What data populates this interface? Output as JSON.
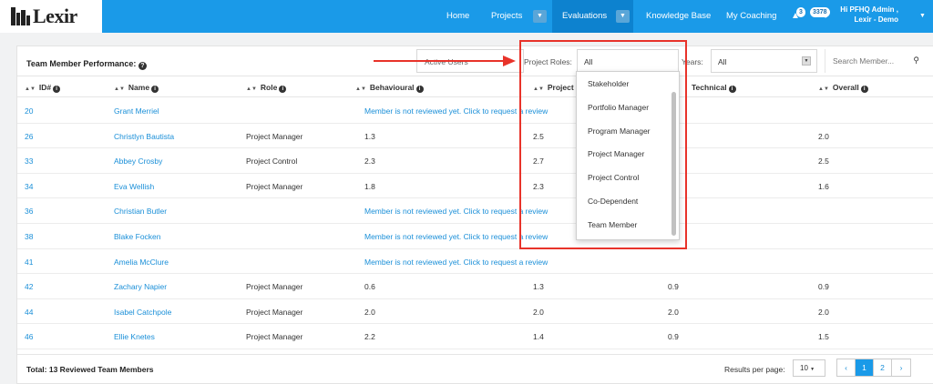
{
  "brand": {
    "logo_text": "Lexir"
  },
  "nav": {
    "items": [
      "Home",
      "Projects",
      "Evaluations",
      "Knowledge Base",
      "My Coaching"
    ],
    "notifications": {
      "alerts": "3",
      "messages": "3378"
    },
    "user_line1": "Hi PFHQ Admin ,",
    "user_line2": "Lexir - Demo"
  },
  "panel": {
    "title": "Team Member Performance:",
    "filters": {
      "users_label": "Active Users",
      "roles_label": "Project Roles:",
      "roles_value": "All",
      "years_label": "Years:",
      "years_value": "All",
      "search_placeholder": "Search Member..."
    },
    "columns": [
      "ID#",
      "Name",
      "Role",
      "Behavioural",
      "Project",
      "Technical",
      "Overall"
    ],
    "not_reviewed_text": "Member is not reviewed yet. Click to request a review",
    "rows": [
      {
        "id": "20",
        "name": "Grant Merriel",
        "role": "",
        "behavioural": "",
        "project": "",
        "technical": "",
        "overall": "",
        "reviewed": false
      },
      {
        "id": "26",
        "name": "Christlyn Bautista",
        "role": "Project Manager",
        "behavioural": "1.3",
        "project": "2.5",
        "technical": "",
        "overall": "2.0",
        "reviewed": true
      },
      {
        "id": "33",
        "name": "Abbey Crosby",
        "role": "Project Control",
        "behavioural": "2.3",
        "project": "2.7",
        "technical": "",
        "overall": "2.5",
        "reviewed": true
      },
      {
        "id": "34",
        "name": "Eva Wellish",
        "role": "Project Manager",
        "behavioural": "1.8",
        "project": "2.3",
        "technical": "",
        "overall": "1.6",
        "reviewed": true
      },
      {
        "id": "36",
        "name": "Christian Butler",
        "role": "",
        "behavioural": "",
        "project": "",
        "technical": "",
        "overall": "",
        "reviewed": false
      },
      {
        "id": "38",
        "name": "Blake Focken",
        "role": "",
        "behavioural": "",
        "project": "",
        "technical": "",
        "overall": "",
        "reviewed": false
      },
      {
        "id": "41",
        "name": "Amelia McClure",
        "role": "",
        "behavioural": "",
        "project": "",
        "technical": "",
        "overall": "",
        "reviewed": false
      },
      {
        "id": "42",
        "name": "Zachary Napier",
        "role": "Project Manager",
        "behavioural": "0.6",
        "project": "1.3",
        "technical": "0.9",
        "overall": "0.9",
        "reviewed": true
      },
      {
        "id": "44",
        "name": "Isabel Catchpole",
        "role": "Project Manager",
        "behavioural": "2.0",
        "project": "2.0",
        "technical": "2.0",
        "overall": "2.0",
        "reviewed": true
      },
      {
        "id": "46",
        "name": "Ellie Knetes",
        "role": "Project Manager",
        "behavioural": "2.2",
        "project": "1.4",
        "technical": "0.9",
        "overall": "1.5",
        "reviewed": true
      }
    ],
    "footer": {
      "total": "Total: 13 Reviewed Team Members",
      "rpp_label": "Results per page:",
      "rpp_value": "10",
      "pages": [
        "1",
        "2"
      ]
    }
  },
  "roles_dropdown": {
    "options": [
      "Stakeholder",
      "Portfolio Manager",
      "Program Manager",
      "Project Manager",
      "Project Control",
      "Co-Dependent",
      "Team Member"
    ]
  },
  "colors": {
    "nav_bg": "#1a9ae8",
    "link": "#1a8fd8",
    "annotation": "#e8332a"
  }
}
